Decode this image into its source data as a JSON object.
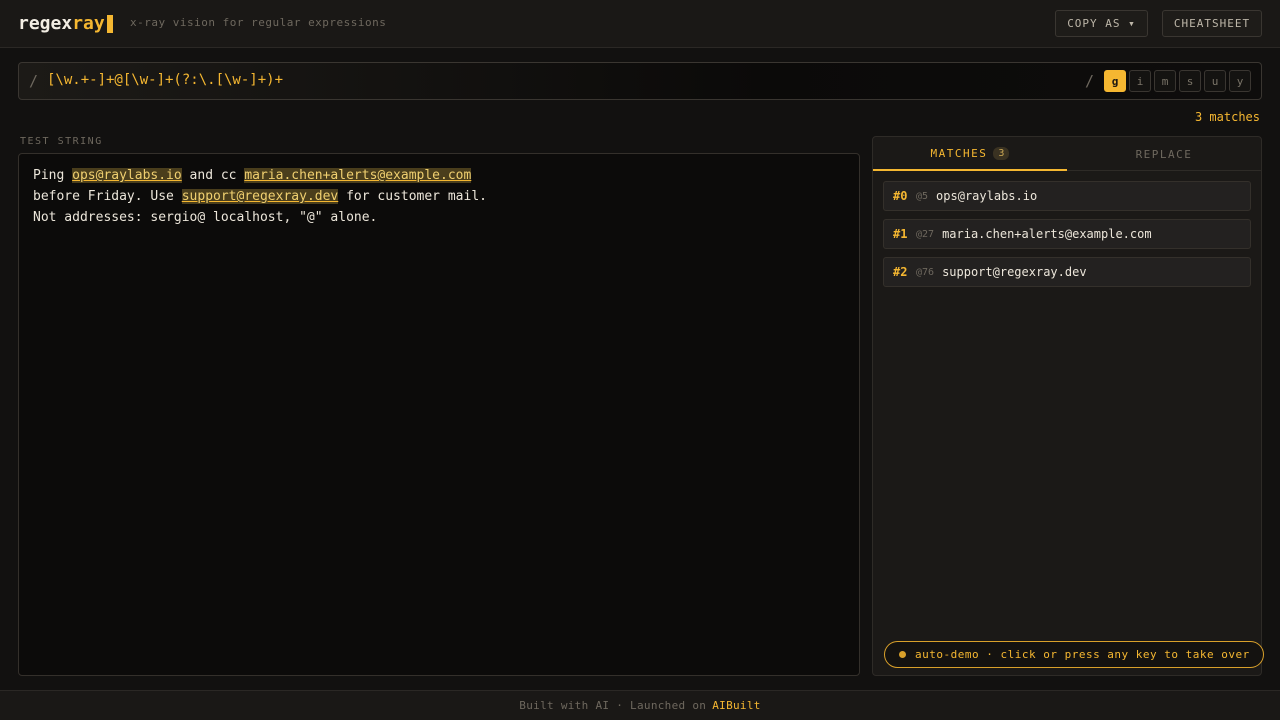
{
  "header": {
    "logo_part1": "regex",
    "logo_part2": "ray",
    "tagline": "x-ray vision for regular expressions",
    "copy_as_label": "COPY AS ▾",
    "cheatsheet_label": "CHEATSHEET"
  },
  "regex": {
    "open_slash": "/",
    "pattern": "[\\w.+-]+@[\\w-]+(?:\\.[\\w-]+)+",
    "close_slash": "/",
    "flags": [
      {
        "label": "g",
        "active": true
      },
      {
        "label": "i",
        "active": false
      },
      {
        "label": "m",
        "active": false
      },
      {
        "label": "s",
        "active": false
      },
      {
        "label": "u",
        "active": false
      },
      {
        "label": "y",
        "active": false
      }
    ],
    "match_count_text": "3 matches"
  },
  "test_string": {
    "label": "TEST STRING",
    "lines": [
      {
        "t0": "Ping ",
        "m0": "ops@raylabs.io",
        "t1": " and cc ",
        "m1": "maria.chen+alerts@example.com",
        "t2": ""
      },
      {
        "t0": "before Friday. Use ",
        "m0": "support@regexray.dev",
        "t1": " for customer mail.",
        "m1": "",
        "t2": ""
      },
      {
        "t0": "Not addresses: sergio@ localhost, \"@\" alone.",
        "m0": "",
        "t1": "",
        "m1": "",
        "t2": ""
      }
    ]
  },
  "panel": {
    "tab_matches": "MATCHES",
    "tab_matches_badge": "3",
    "tab_replace": "REPLACE",
    "matches": [
      {
        "index": "#0",
        "pos": "@5",
        "text": "ops@raylabs.io"
      },
      {
        "index": "#1",
        "pos": "@27",
        "text": "maria.chen+alerts@example.com"
      },
      {
        "index": "#2",
        "pos": "@76",
        "text": "support@regexray.dev"
      }
    ]
  },
  "demo_banner": "auto-demo · click or press any key to take over",
  "footer": {
    "text": "Built with AI · Launched on",
    "brand": "AIBuilt"
  },
  "colors": {
    "accent": "#f5b731",
    "background": "#121110",
    "highlight": "#4a3e1c"
  }
}
